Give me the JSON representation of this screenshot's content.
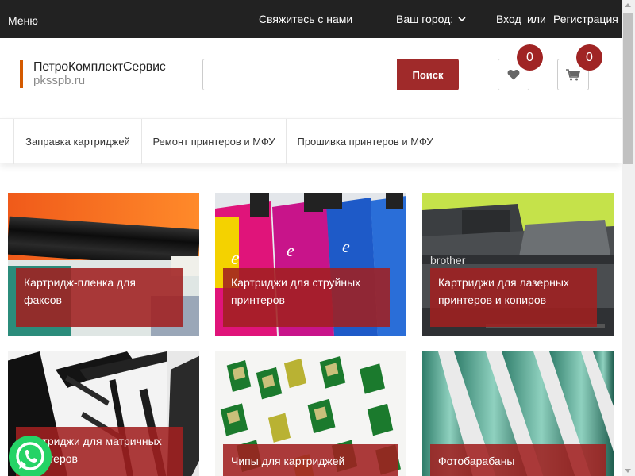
{
  "topbar": {
    "menu": "Меню",
    "contact": "Свяжитесь с нами",
    "city": "Ваш город:",
    "login": "Вход",
    "or": "или",
    "register": "Регистрация"
  },
  "logo": {
    "name": "ПетроКомплектСервис",
    "domain": "pkssрb.ru"
  },
  "search": {
    "value": "",
    "button": "Поиск"
  },
  "favorites": {
    "count": "0",
    "icon": "heart-icon"
  },
  "cart": {
    "count": "0",
    "icon": "cart-icon"
  },
  "nav": {
    "tabs": [
      "Заправка картриджей",
      "Ремонт принтеров и МФУ",
      "Прошивка принтеров и МФУ"
    ]
  },
  "categories": [
    {
      "label": "Картридж-пленка для факсов"
    },
    {
      "label": "Картриджи для струйных принтеров"
    },
    {
      "label": "Картриджи для лазерных принтеров и копиров"
    },
    {
      "label": "Картриджи для матричных принтеров"
    },
    {
      "label": "Чипы для картриджей"
    },
    {
      "label": "Фотобарабаны"
    }
  ],
  "colors": {
    "topbar": "#222222",
    "accent": "#a02a2a",
    "logo_bar": "#d45a00",
    "whatsapp": "#25d366"
  }
}
